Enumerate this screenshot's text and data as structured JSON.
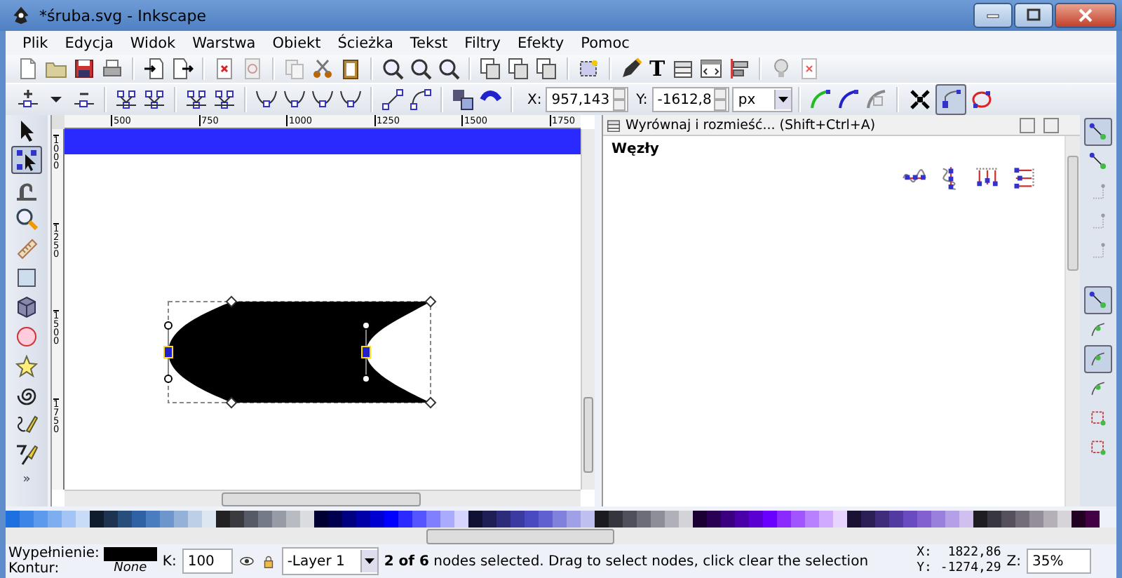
{
  "window": {
    "title": "*śruba.svg - Inkscape"
  },
  "menu": [
    {
      "label": "Plik"
    },
    {
      "label": "Edycja"
    },
    {
      "label": "Widok"
    },
    {
      "label": "Warstwa"
    },
    {
      "label": "Obiekt"
    },
    {
      "label": "Ścieżka"
    },
    {
      "label": "Tekst"
    },
    {
      "label": "Filtry"
    },
    {
      "label": "Efekty"
    },
    {
      "label": "Pomoc"
    }
  ],
  "commands_bar": {
    "text_tool_glyph": "T"
  },
  "node_toolbar": {
    "x_label": "X:",
    "x_value": "957,143",
    "y_label": "Y:",
    "y_value": "-1612,8",
    "unit": "px",
    "show_handles": true,
    "show_outline": false,
    "show_transform": false
  },
  "toolbox": {
    "tools": [
      {
        "selected": false
      },
      {
        "selected": true
      },
      {
        "selected": false
      },
      {
        "selected": false
      },
      {
        "selected": false
      },
      {
        "selected": false
      },
      {
        "selected": false
      },
      {
        "selected": false
      },
      {
        "selected": false
      },
      {
        "selected": false
      },
      {
        "selected": false
      },
      {
        "selected": false
      }
    ],
    "more": "»"
  },
  "ruler": {
    "top_labels": [
      "500",
      "750",
      "1000",
      "1250",
      "1500",
      "1750"
    ],
    "side_labels": [
      "1000",
      "1250",
      "1500",
      "1750"
    ]
  },
  "dock": {
    "title": "Wyrównaj i rozmieść... (Shift+Ctrl+A)",
    "heading": "Węzły"
  },
  "snap_bar": [
    {
      "on": true
    },
    {
      "on": false
    },
    {
      "on": false
    },
    {
      "on": false
    },
    {
      "on": false
    },
    {
      "on": true
    },
    {
      "on": false
    },
    {
      "on": true
    },
    {
      "on": false
    },
    {
      "on": false
    },
    {
      "on": false
    }
  ],
  "palette": [
    {
      "color": "#1e6fe0"
    },
    {
      "color": "#3d86e8"
    },
    {
      "color": "#5c9aee"
    },
    {
      "color": "#7daef0"
    },
    {
      "color": "#a3c4f4"
    },
    {
      "color": "#c8dcf8"
    },
    {
      "color": "#0f1c2e"
    },
    {
      "color": "#1d3350"
    },
    {
      "color": "#284e7c"
    },
    {
      "color": "#2f62a4"
    },
    {
      "color": "#4a7cc0"
    },
    {
      "color": "#6d96cc"
    },
    {
      "color": "#94b2d8"
    },
    {
      "color": "#bccfe6"
    },
    {
      "color": "#dde7f2"
    },
    {
      "color": "#222222"
    },
    {
      "color": "#3a3a3f"
    },
    {
      "color": "#555a66"
    },
    {
      "color": "#757a88"
    },
    {
      "color": "#979ba5"
    },
    {
      "color": "#b8bbc2"
    },
    {
      "color": "#dadce0"
    },
    {
      "color": "#000033"
    },
    {
      "color": "#00004d"
    },
    {
      "color": "#000080"
    },
    {
      "color": "#0000a8"
    },
    {
      "color": "#0000d0"
    },
    {
      "color": "#0000ff"
    },
    {
      "color": "#2a2aff"
    },
    {
      "color": "#5555ff"
    },
    {
      "color": "#8080ff"
    },
    {
      "color": "#aaaaff"
    },
    {
      "color": "#d5d5ff"
    },
    {
      "color": "#111133"
    },
    {
      "color": "#1f1f55"
    },
    {
      "color": "#2c2c7a"
    },
    {
      "color": "#3a3aa0"
    },
    {
      "color": "#4a4ac0"
    },
    {
      "color": "#6060d0"
    },
    {
      "color": "#8080dd"
    },
    {
      "color": "#a0a0e6"
    },
    {
      "color": "#c0c0f0"
    },
    {
      "color": "#1a1a1f"
    },
    {
      "color": "#35353d"
    },
    {
      "color": "#50505c"
    },
    {
      "color": "#6d6d7a"
    },
    {
      "color": "#8e8e99"
    },
    {
      "color": "#b0b0b8"
    },
    {
      "color": "#d4d4d8"
    },
    {
      "color": "#1a0033"
    },
    {
      "color": "#2a0055"
    },
    {
      "color": "#3a0080"
    },
    {
      "color": "#4a00a8"
    },
    {
      "color": "#5a00d0"
    },
    {
      "color": "#6a00ff"
    },
    {
      "color": "#8a2aff"
    },
    {
      "color": "#a055ff"
    },
    {
      "color": "#b880ff"
    },
    {
      "color": "#d0aaff"
    },
    {
      "color": "#e8d5ff"
    },
    {
      "color": "#1a1133"
    },
    {
      "color": "#2c1f55"
    },
    {
      "color": "#3f2c7a"
    },
    {
      "color": "#523aa0"
    },
    {
      "color": "#6a4ac0"
    },
    {
      "color": "#8260d0"
    },
    {
      "color": "#9a80dd"
    },
    {
      "color": "#b4a0e6"
    },
    {
      "color": "#d0c0f0"
    },
    {
      "color": "#1e1e22"
    },
    {
      "color": "#38363f"
    },
    {
      "color": "#55505c"
    },
    {
      "color": "#736d7a"
    },
    {
      "color": "#948e99"
    },
    {
      "color": "#b5b0b8"
    },
    {
      "color": "#d6d4d8"
    },
    {
      "color": "#220022"
    },
    {
      "color": "#440044"
    }
  ],
  "status_bar": {
    "fill_label": "Wypełnienie:",
    "fill": {
      "color": "#000000"
    },
    "stroke_label": "Kontur:",
    "stroke_value": "None",
    "opacity_label": "K:",
    "opacity_value": "100",
    "layer": "-Layer 1",
    "message": "**2 of 6** nodes selected. Drag to select nodes, click clear the selection",
    "x_label": "X:",
    "x_value": "1822,86",
    "y_label": "Y:",
    "y_value": "-1274,29",
    "zoom_label": "Z:",
    "zoom_value": "35%"
  }
}
